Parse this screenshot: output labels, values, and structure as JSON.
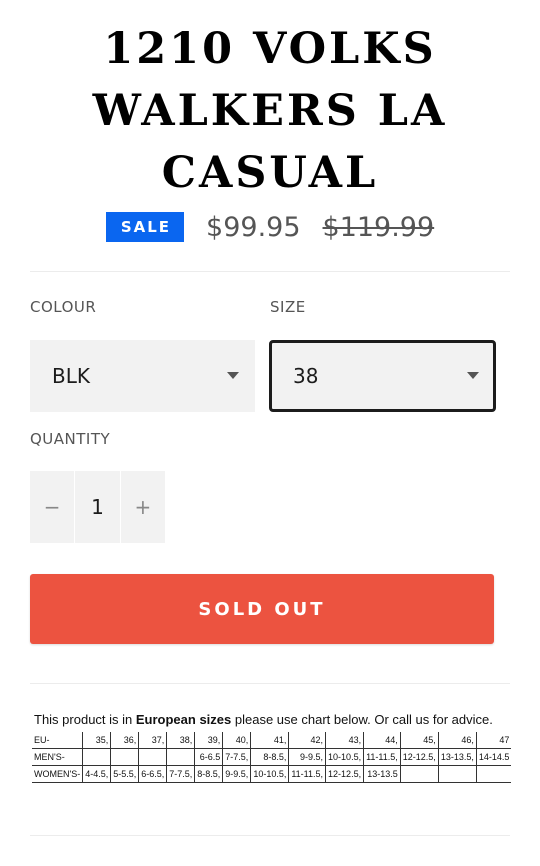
{
  "product": {
    "title_lines": [
      "1210 VOLKS",
      "WALKERS LA",
      "CASUAL"
    ],
    "sale_badge": "SALE",
    "price_current": "$99.95",
    "price_old": "$119.99"
  },
  "options": {
    "colour_label": "COLOUR",
    "colour_value": "BLK",
    "size_label": "SIZE",
    "size_value": "38",
    "quantity_label": "QUANTITY",
    "quantity_value": "1",
    "decrement_symbol": "−",
    "increment_symbol": "+"
  },
  "cta": {
    "sold_out_label": "SOLD OUT",
    "color": "#ec5340"
  },
  "size_chart": {
    "intro_prefix": "This product is in ",
    "intro_bold": "European sizes",
    "intro_suffix": " please use chart below. Or call us for advice.",
    "rows": [
      [
        "EU-",
        "35,",
        "36,",
        "37,",
        "38,",
        "39,",
        "40,",
        "41,",
        "42,",
        "43,",
        "44,",
        "45,",
        "46,",
        "47"
      ],
      [
        "MEN'S-",
        "",
        "",
        "",
        "",
        "6-6.5",
        "7-7.5,",
        "8-8.5,",
        "9-9.5,",
        "10-10.5,",
        "11-11.5,",
        "12-12.5,",
        "13-13.5,",
        "14-14.5"
      ],
      [
        "WOMEN'S-",
        "4-4.5,",
        "5-5.5,",
        "6-6.5,",
        "7-7.5,",
        "8-8.5,",
        "9-9.5,",
        "10-10.5,",
        "11-11.5,",
        "12-12.5,",
        "13-13.5",
        "",
        "",
        ""
      ]
    ]
  },
  "colors": {
    "sale_badge": "#0a66f0",
    "sold_out": "#ec5340"
  }
}
